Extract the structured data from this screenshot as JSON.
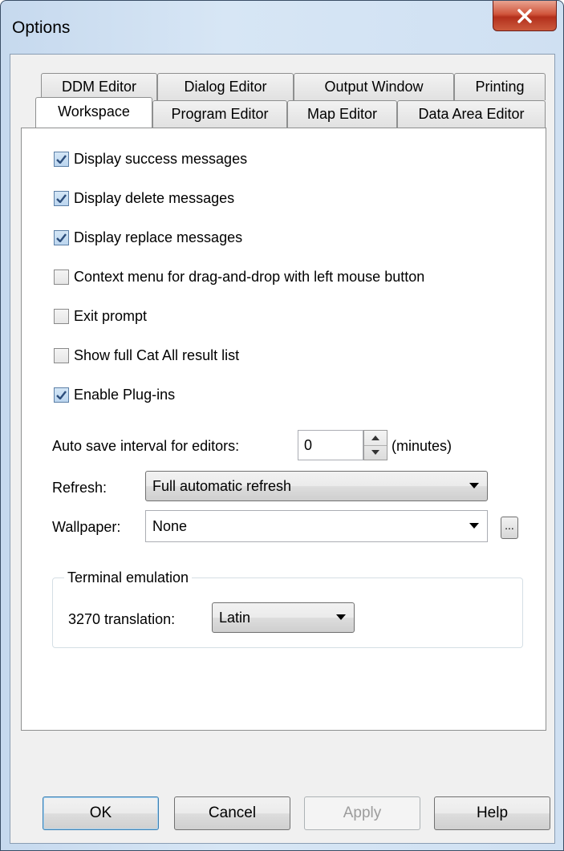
{
  "window": {
    "title": "Options"
  },
  "tabs": {
    "row1": [
      "DDM Editor",
      "Dialog Editor",
      "Output Window",
      "Printing"
    ],
    "row2": [
      "Workspace",
      "Program Editor",
      "Map Editor",
      "Data Area Editor"
    ],
    "active": "Workspace"
  },
  "workspace": {
    "checkboxes": [
      {
        "label": "Display success messages",
        "checked": true
      },
      {
        "label": "Display delete messages",
        "checked": true
      },
      {
        "label": "Display replace messages",
        "checked": true
      },
      {
        "label": "Context menu for drag-and-drop with left mouse button",
        "checked": false
      },
      {
        "label": "Exit prompt",
        "checked": false
      },
      {
        "label": "Show full Cat All result list",
        "checked": false
      },
      {
        "label": "Enable Plug-ins",
        "checked": true
      }
    ],
    "autosave": {
      "label": "Auto save interval for editors:",
      "value": "0",
      "unit": "(minutes)"
    },
    "refresh": {
      "label": "Refresh:",
      "value": "Full automatic refresh"
    },
    "wallpaper": {
      "label": "Wallpaper:",
      "value": "None",
      "browse": "..."
    },
    "terminal": {
      "group_title": "Terminal emulation",
      "translation_label": "3270 translation:",
      "translation_value": "Latin"
    }
  },
  "buttons": {
    "ok": "OK",
    "cancel": "Cancel",
    "apply": "Apply",
    "help": "Help"
  }
}
